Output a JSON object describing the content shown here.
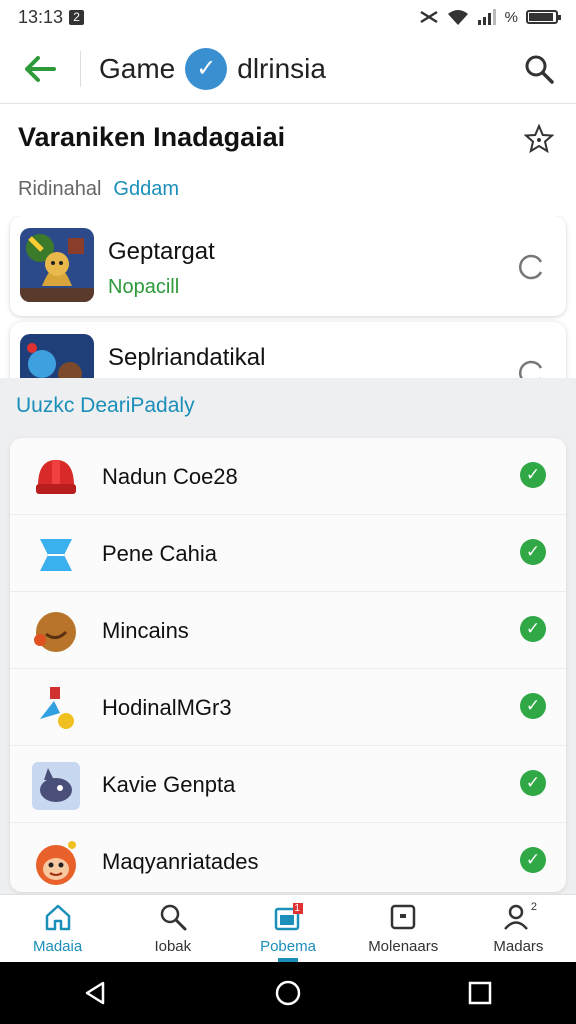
{
  "status": {
    "time": "13:13",
    "left_glyph": "2",
    "right_glyph": "%",
    "colors": {
      "icon": "#333333"
    }
  },
  "appbar": {
    "title_left": "Game",
    "title_right": "dlrinsia",
    "back_icon": "arrow-left-icon",
    "search_icon": "search-icon",
    "accent": "#2e9a3b",
    "verify_color": "#3a8fd1"
  },
  "section": {
    "title": "Varaniken Inadagaiai",
    "subtab_1": "Ridinahal",
    "subtab_2": "Gddam",
    "star_icon": "star-icon"
  },
  "cards": [
    {
      "name": "Geptargat",
      "sub": "Nopacill"
    },
    {
      "name": "Seplriandatikal",
      "sub": ""
    }
  ],
  "list": {
    "title": "Uuzkc DeariPadaly",
    "items": [
      {
        "label": "Nadun Coe28",
        "icon": "helmet-icon"
      },
      {
        "label": "Pene Cahia",
        "icon": "crystal-icon"
      },
      {
        "label": "Mincains",
        "icon": "cookie-face-icon"
      },
      {
        "label": "HodinalMGr3",
        "icon": "character-icon"
      },
      {
        "label": "Kavie Genpta",
        "icon": "creature-icon"
      },
      {
        "label": "Maqyanriatades",
        "icon": "monkey-icon"
      }
    ],
    "check_color": "#2fa845"
  },
  "bottomnav": [
    {
      "label": "Madaia",
      "icon": "home-icon"
    },
    {
      "label": "Iobak",
      "icon": "search-icon"
    },
    {
      "label": "Pobema",
      "icon": "calendar-badge-icon"
    },
    {
      "label": "Molenaars",
      "icon": "square-dot-icon"
    },
    {
      "label": "Madars",
      "icon": "user-icon"
    }
  ],
  "badge": "1",
  "user_badge": "2",
  "accent_blue": "#1b8fb9"
}
